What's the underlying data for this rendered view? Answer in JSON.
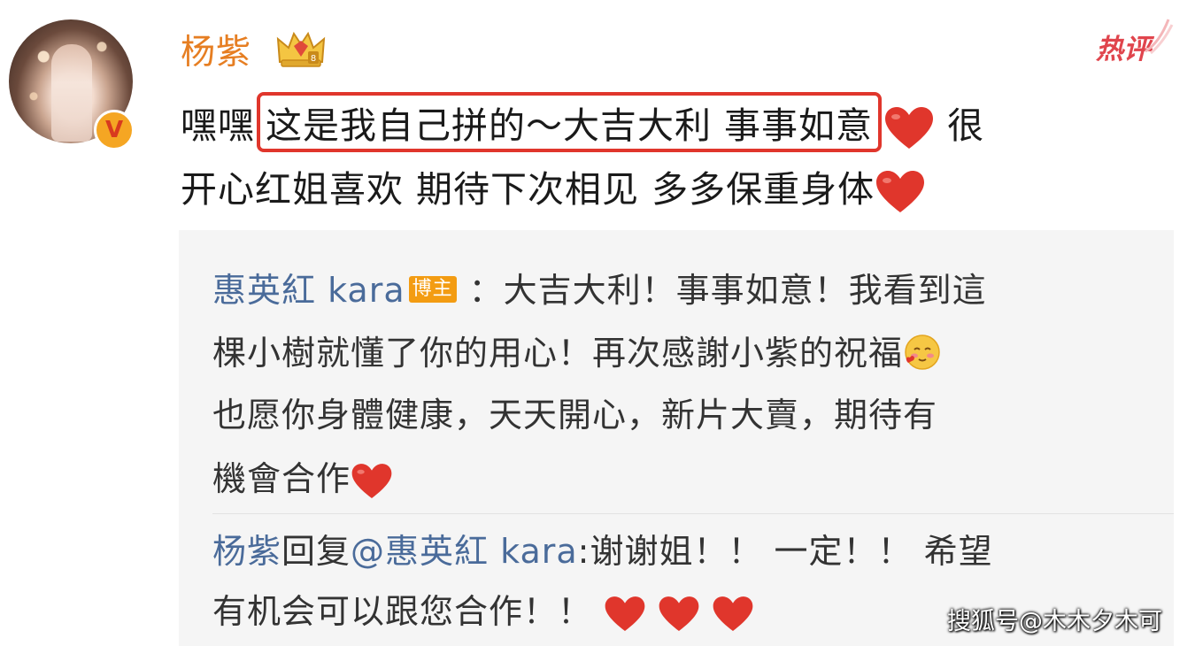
{
  "post": {
    "username": "杨紫",
    "hot_label": "热评",
    "line1_prefix": "嘿嘿",
    "line1_highlight": "这是我自己拼的～大吉大利 事事如意",
    "line1_suffix": "很",
    "line2": "开心红姐喜欢 期待下次相见 多多保重身体"
  },
  "reply": {
    "author": "惠英紅 kara",
    "author_tag": "博主",
    "text_l1": "：大吉大利！事事如意！我看到這",
    "text_l2": "棵小樹就懂了你的用心！再次感謝小紫的祝福",
    "text_l3": "也愿你身體健康，天天開心，新片大賣，期待有",
    "text_l4": "機會合作"
  },
  "sub_reply": {
    "author": "杨紫",
    "reply_word": "回复",
    "mention": "@惠英紅 kara",
    "text_l1": ":谢谢姐！！ 一定！！ 希望",
    "text_l2": "有机会可以跟您合作！！"
  },
  "watermark": "搜狐号@木木夕木可",
  "colors": {
    "username": "#e67e22",
    "link": "#4a6b9a",
    "highlight_border": "#e0362c",
    "heart": "#e0362c",
    "tag_bg": "#f39c12",
    "reply_bg": "#f5f5f5"
  },
  "icons": [
    "verified-badge-icon",
    "vip-crown-icon",
    "heart-icon",
    "blush-emoji-icon"
  ]
}
